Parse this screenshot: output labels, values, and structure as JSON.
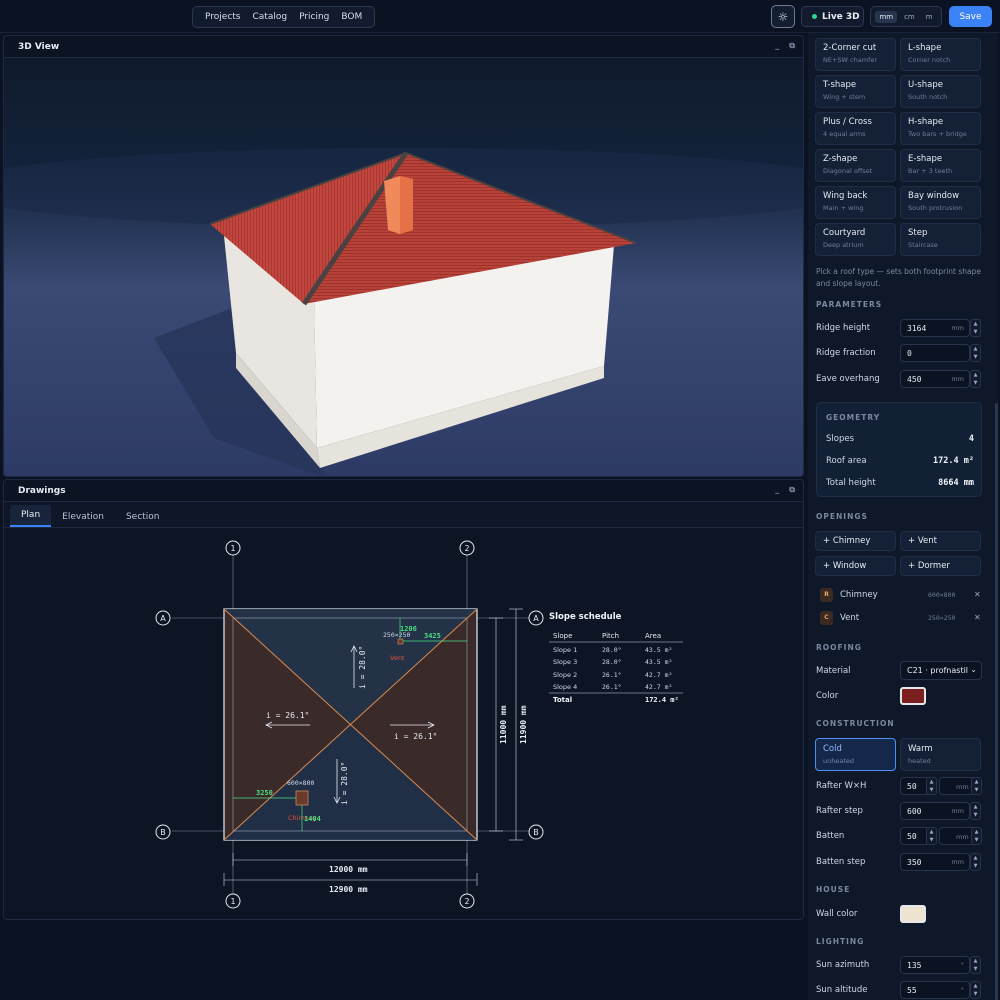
{
  "topbar": {
    "nav": [
      "Projects",
      "Catalog",
      "Pricing",
      "BOM"
    ],
    "live_label": "Live 3D",
    "units": [
      "mm",
      "cm",
      "m"
    ],
    "save_label": "Save",
    "sun_icon": "sun-icon"
  },
  "view3d": {
    "title": "3D View",
    "minimize": "_",
    "restore": "⧉"
  },
  "drawings": {
    "title": "Drawings",
    "tabs": [
      "Plan",
      "Elevation",
      "Section"
    ],
    "active_tab": "Plan",
    "plan": {
      "axes": [
        "1",
        "2",
        "A",
        "B"
      ],
      "slope_labels": [
        "i = 26.1°",
        "i = 26.1°",
        "i = 28.0°",
        "i = 28.0°"
      ],
      "chimney_label": "Chimney",
      "chimney_size": "600×800",
      "chimney_dim_x": "3250",
      "chimney_dim_y": "1404",
      "vent_label": "Vent",
      "vent_size": "250×250",
      "vent_dim_x": "3425",
      "vent_dim_y": "1206",
      "dim_width_inner": "12000 mm",
      "dim_width_outer": "12900 mm",
      "dim_depth_inner": "11000 mm",
      "dim_depth_outer": "11900 mm"
    },
    "schedule": {
      "title": "Slope schedule",
      "headers": [
        "Slope",
        "Pitch",
        "Area"
      ],
      "rows": [
        [
          "Slope 1",
          "28.0°",
          "43.5 m²"
        ],
        [
          "Slope 3",
          "28.0°",
          "43.5 m²"
        ],
        [
          "Slope 2",
          "26.1°",
          "42.7 m²"
        ],
        [
          "Slope 4",
          "26.1°",
          "42.7 m²"
        ]
      ],
      "total_label": "Total",
      "total_value": "172.4 m²"
    }
  },
  "sidebar": {
    "shapes": [
      {
        "title": "2-Corner cut",
        "sub": "NE+SW chamfer"
      },
      {
        "title": "L-shape",
        "sub": "Corner notch"
      },
      {
        "title": "T-shape",
        "sub": "Wing + stem"
      },
      {
        "title": "U-shape",
        "sub": "South notch"
      },
      {
        "title": "Plus / Cross",
        "sub": "4 equal arms"
      },
      {
        "title": "H-shape",
        "sub": "Two bars + bridge"
      },
      {
        "title": "Z-shape",
        "sub": "Diagonal offset"
      },
      {
        "title": "E-shape",
        "sub": "Bar + 3 teeth"
      },
      {
        "title": "Wing back",
        "sub": "Main + wing"
      },
      {
        "title": "Bay window",
        "sub": "South protrusion"
      },
      {
        "title": "Courtyard",
        "sub": "Deep atrium"
      },
      {
        "title": "Step",
        "sub": "Staircase"
      }
    ],
    "hint": "Pick a roof type — sets both footprint shape and slope layout.",
    "parameters": {
      "title": "PARAMETERS",
      "ridge_height_label": "Ridge height",
      "ridge_height": "3164",
      "ridge_height_unit": "mm",
      "ridge_fraction_label": "Ridge fraction",
      "ridge_fraction": "0",
      "eave_label": "Eave overhang",
      "eave": "450",
      "eave_unit": "mm"
    },
    "geometry": {
      "title": "GEOMETRY",
      "slopes_label": "Slopes",
      "slopes": "4",
      "roof_area_label": "Roof area",
      "roof_area": "172.4 m²",
      "total_height_label": "Total height",
      "total_height": "8664 mm"
    },
    "openings": {
      "title": "OPENINGS",
      "buttons": [
        "+ Chimney",
        "+ Vent",
        "+ Window",
        "+ Dormer"
      ],
      "items": [
        {
          "icon": "R",
          "name": "Chimney",
          "size": "600×800"
        },
        {
          "icon": "C",
          "name": "Vent",
          "size": "250×250"
        }
      ]
    },
    "roofing": {
      "title": "ROOFING",
      "material_label": "Material",
      "material": "C21 · profnastil",
      "color_label": "Color",
      "color": "#7a1e1e"
    },
    "construction": {
      "title": "CONSTRUCTION",
      "cold": "Cold",
      "cold_sub": "unheated",
      "warm": "Warm",
      "warm_sub": "heated",
      "rafter_wh_label": "Rafter W×H",
      "rafter_wh": "50",
      "rafter_wh_unit": "mm",
      "rafter_step_label": "Rafter step",
      "rafter_step": "600",
      "rafter_step_unit": "mm",
      "batten_label": "Batten",
      "batten": "50",
      "batten_unit": "mm",
      "batten_step_label": "Batten step",
      "batten_step": "350",
      "batten_step_unit": "mm"
    },
    "house": {
      "title": "HOUSE",
      "wall_color_label": "Wall color",
      "wall_color": "#ede3cf"
    },
    "lighting": {
      "title": "LIGHTING",
      "sun_azimuth_label": "Sun azimuth",
      "sun_azimuth": "135",
      "deg": "°",
      "sun_altitude_label": "Sun altitude",
      "sun_altitude": "55"
    }
  }
}
